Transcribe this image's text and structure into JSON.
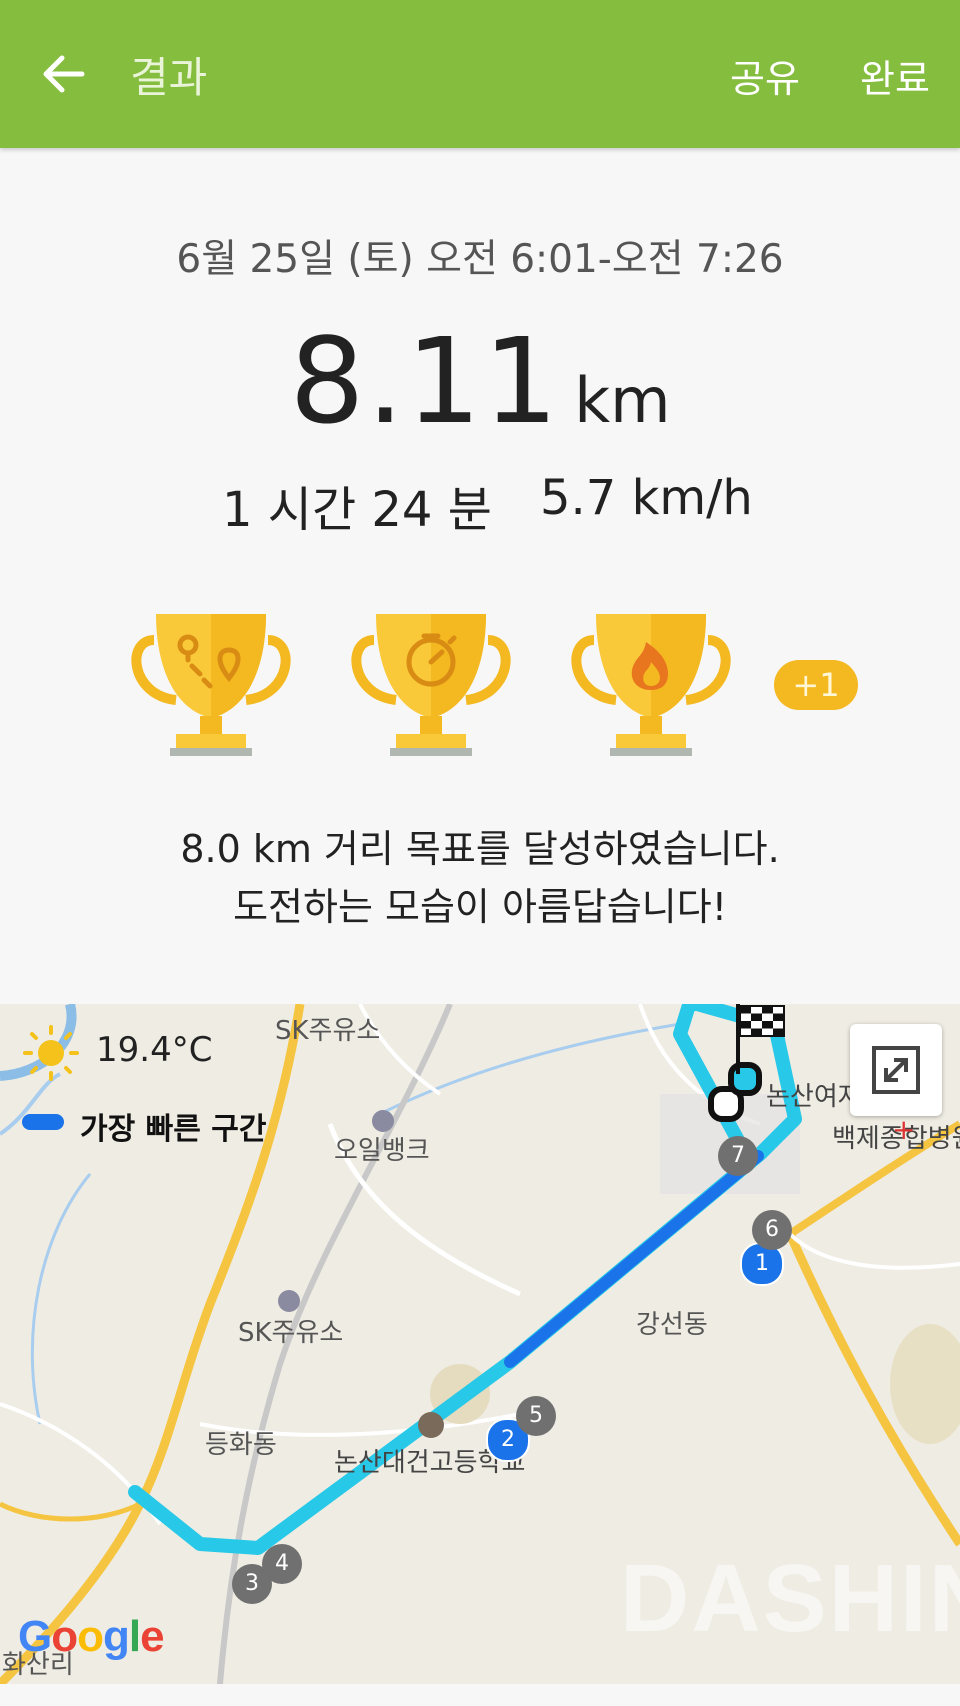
{
  "appbar": {
    "title": "결과",
    "share_label": "공유",
    "done_label": "완료",
    "back_icon": "arrow-left-icon",
    "color": "#85bd3f"
  },
  "summary": {
    "date_range": "6월 25일 (토) 오전 6:01-오전 7:26",
    "distance_value": "8.11",
    "distance_unit": "km",
    "duration": "1 시간 24 분",
    "speed": "5.7 km/h"
  },
  "achievements": {
    "trophies": [
      {
        "icon": "route-pins-icon"
      },
      {
        "icon": "stopwatch-icon"
      },
      {
        "icon": "flame-icon"
      }
    ],
    "more_label": "+1",
    "trophy_color": "#f4b820"
  },
  "message": {
    "line1": "8.0 km 거리 목표를 달성하였습니다.",
    "line2": "도전하는 모습이 아름답습니다!"
  },
  "map": {
    "weather_icon": "sun-icon",
    "temperature": "19.4°C",
    "legend_label": "가장 빠른 구간",
    "legend_color": "#1a73e8",
    "route_color": "#28c8e8",
    "labels": {
      "sk1": "SK주유소",
      "oil_bank": "오일뱅크",
      "sk2": "SK주유소",
      "ganseon": "강선동",
      "deunghwa": "등화동",
      "school": "논산대건고등학교",
      "girls_school": "논산여자",
      "hospital": "백제종합병원",
      "hwasan": "화산리"
    },
    "markers": [
      "1",
      "2",
      "3",
      "4",
      "5",
      "6",
      "7"
    ],
    "google_letters": [
      "G",
      "o",
      "o",
      "g",
      "l",
      "e"
    ],
    "watermark": "DASHIN"
  }
}
